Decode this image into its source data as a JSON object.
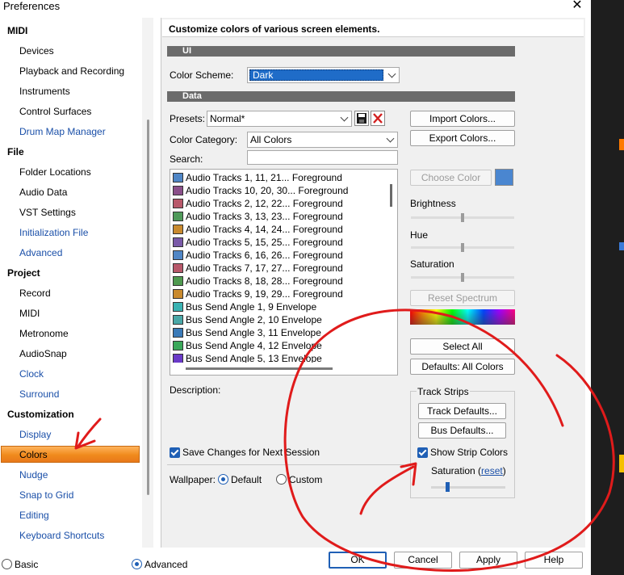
{
  "window": {
    "title": "Preferences",
    "close_icon": "close-icon"
  },
  "nav": {
    "sections": [
      {
        "header": "MIDI",
        "items": [
          "Devices",
          "Playback and Recording",
          "Instruments",
          "Control Surfaces",
          "Drum Map Manager"
        ]
      },
      {
        "header": "File",
        "items": [
          "Folder Locations",
          "Audio Data",
          "VST Settings",
          "Initialization File",
          "Advanced"
        ]
      },
      {
        "header": "Project",
        "items": [
          "Record",
          "MIDI",
          "Metronome",
          "AudioSnap",
          "Clock",
          "Surround"
        ]
      },
      {
        "header": "Customization",
        "items": [
          "Display",
          "Colors",
          "Nudge",
          "Snap to Grid",
          "Editing",
          "Keyboard Shortcuts"
        ]
      }
    ],
    "selected": "Colors"
  },
  "content": {
    "header": "Customize colors of various screen elements.",
    "ui_section": "UI",
    "color_scheme_label": "Color Scheme:",
    "color_scheme_value": "Dark",
    "data_section": "Data",
    "presets_label": "Presets:",
    "presets_value": "Normal*",
    "color_category_label": "Color Category:",
    "color_category_value": "All Colors",
    "search_label": "Search:",
    "search_value": "",
    "list": [
      {
        "label": "Audio Tracks 1, 11, 21... Foreground",
        "color": "#4f86c6"
      },
      {
        "label": "Audio Tracks 10, 20, 30... Foreground",
        "color": "#8a4f8a"
      },
      {
        "label": "Audio Tracks 2, 12, 22... Foreground",
        "color": "#b8586a"
      },
      {
        "label": "Audio Tracks 3, 13, 23... Foreground",
        "color": "#4f9a5a"
      },
      {
        "label": "Audio Tracks 4, 14, 24... Foreground",
        "color": "#c98a2e"
      },
      {
        "label": "Audio Tracks 5, 15, 25... Foreground",
        "color": "#7a5aa8"
      },
      {
        "label": "Audio Tracks 6, 16, 26... Foreground",
        "color": "#4f86c6"
      },
      {
        "label": "Audio Tracks 7, 17, 27... Foreground",
        "color": "#b8586a"
      },
      {
        "label": "Audio Tracks 8, 18, 28... Foreground",
        "color": "#4f9a4f"
      },
      {
        "label": "Audio Tracks 9, 19, 29... Foreground",
        "color": "#c98a2e"
      },
      {
        "label": "Bus Send Angle 1, 9 Envelope",
        "color": "#3ab3b3"
      },
      {
        "label": "Bus Send Angle 2, 10 Envelope",
        "color": "#4aa8a8"
      },
      {
        "label": "Bus Send Angle 3, 11 Envelope",
        "color": "#3a7ab8"
      },
      {
        "label": "Bus Send Angle 4, 12 Envelope",
        "color": "#3aa85a"
      },
      {
        "label": "Bus Send Angle 5, 13 Envelope",
        "color": "#6a3ac8"
      }
    ],
    "import_colors": "Import Colors...",
    "export_colors": "Export Colors...",
    "choose_color": "Choose Color",
    "chosen_color": "#4a86d0",
    "brightness_label": "Brightness",
    "brightness": 0.5,
    "hue_label": "Hue",
    "hue": 0.5,
    "saturation_label": "Saturation",
    "saturation": 0.5,
    "reset_spectrum": "Reset Spectrum",
    "select_all": "Select All",
    "defaults_all_colors": "Defaults: All Colors",
    "description_label": "Description:",
    "track_strips_label": "Track Strips",
    "track_defaults": "Track Defaults...",
    "bus_defaults": "Bus Defaults...",
    "show_strip_colors": "Show Strip Colors",
    "strip_saturation_label": "Saturation (",
    "strip_saturation_reset": "reset",
    "strip_saturation_close": ")",
    "strip_saturation": 0.2,
    "save_changes": "Save Changes for Next Session",
    "wallpaper_label": "Wallpaper:",
    "wallpaper_default": "Default",
    "wallpaper_custom": "Custom"
  },
  "footer": {
    "basic": "Basic",
    "advanced": "Advanced",
    "ok": "OK",
    "cancel": "Cancel",
    "apply": "Apply",
    "help": "Help"
  }
}
